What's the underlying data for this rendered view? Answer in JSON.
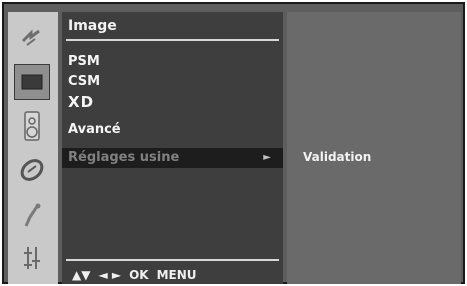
{
  "menu": {
    "title": "Image",
    "items": [
      {
        "label": "PSM"
      },
      {
        "label": "CSM"
      },
      {
        "label": "XD"
      },
      {
        "label": "Avancé"
      },
      {
        "label": "Réglages usine",
        "arrow": "►"
      }
    ]
  },
  "nav": {
    "updown": "▲▼",
    "leftright": "◄ ►",
    "ok": "OK",
    "menu": "MENU"
  },
  "submenu": {
    "value": "Validation"
  },
  "icons": [
    "tv-input-icon",
    "picture-icon",
    "sound-icon",
    "time-icon",
    "special-icon",
    "setup-icon"
  ]
}
